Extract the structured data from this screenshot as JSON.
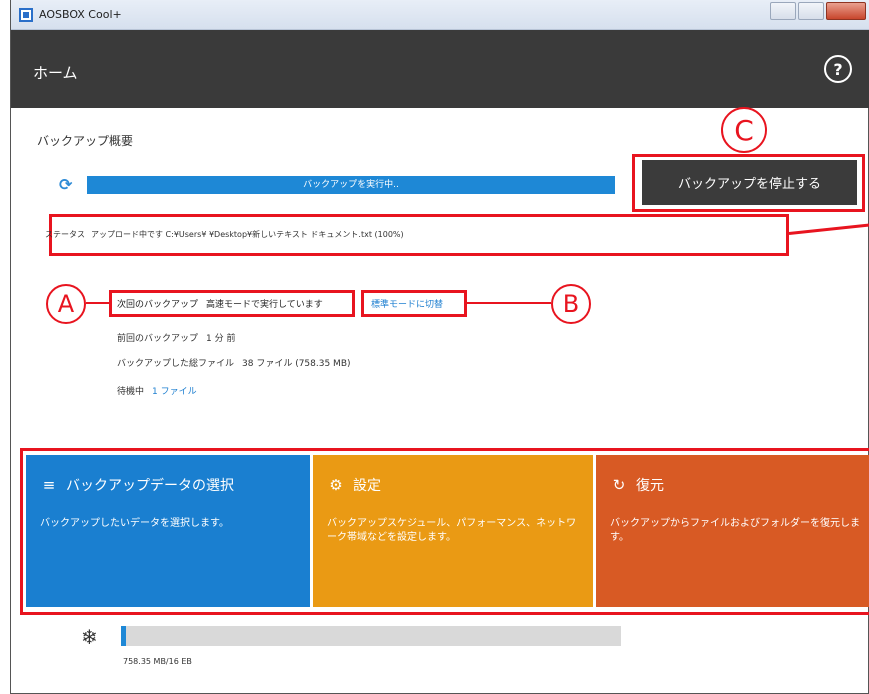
{
  "window": {
    "title": "AOSBOX Cool+"
  },
  "header": {
    "page_title": "ホーム",
    "help_icon": "question-circle-icon",
    "help_label": "?"
  },
  "overview": {
    "section_title": "バックアップ概要",
    "progress_text": "バックアップを実行中..",
    "stop_button": "バックアップを停止する",
    "status_label": "ステータス",
    "status_text": "アップロード中です C:¥Users¥          ¥Desktop¥新しいテキスト ドキュメント.txt (100%)"
  },
  "details": {
    "next_label": "次回のバックアップ",
    "next_value": "高速モードで実行しています",
    "switch_link": "標準モードに切替",
    "last_label": "前回のバックアップ",
    "last_value": "1 分 前",
    "total_label": "バックアップした総ファイル",
    "total_value": "38 ファイル (758.35 MB)",
    "pending_label": "待機中",
    "pending_value": "1 ファイル"
  },
  "tiles": [
    {
      "icon": "list-icon",
      "glyph": "≡",
      "title": "バックアップデータの選択",
      "desc": "バックアップしたいデータを選択します。",
      "color": "#1a7fd0"
    },
    {
      "icon": "gear-icon",
      "glyph": "⚙",
      "title": "設定",
      "desc": "バックアップスケジュール、パフォーマンス、ネットワーク帯域などを設定します。",
      "color": "#ea9a14"
    },
    {
      "icon": "restore-icon",
      "glyph": "↻",
      "title": "復元",
      "desc": "バックアップからファイルおよびフォルダーを復元します。",
      "color": "#d85a24"
    }
  ],
  "storage": {
    "icon": "snowflake-icon",
    "glyph": "❄",
    "usage_text": "758.35 MB/16 EB",
    "used_fraction": 0.01
  },
  "annotations": {
    "a": "A",
    "b": "B",
    "c": "C"
  },
  "colors": {
    "header": "#3a3a3a",
    "progress": "#1e88d6",
    "annotation": "#e8141f"
  }
}
